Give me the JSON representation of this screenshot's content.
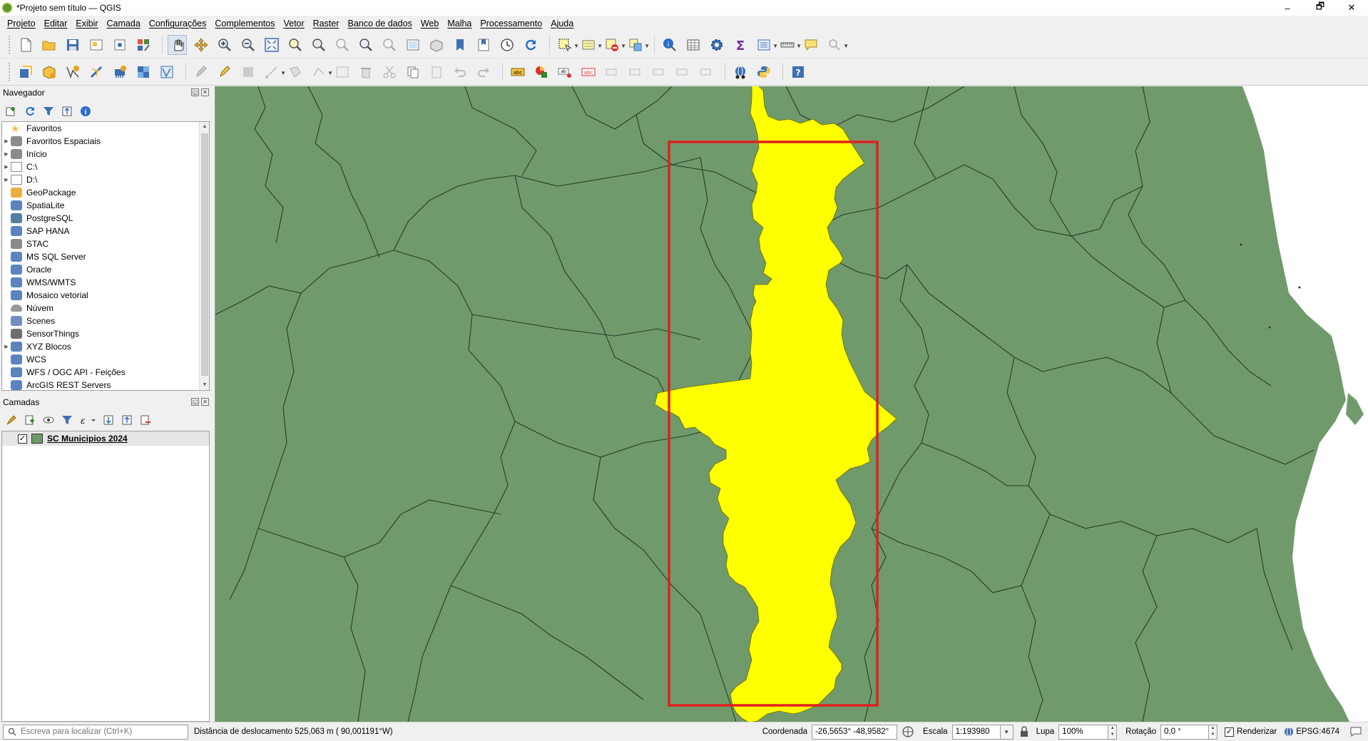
{
  "window": {
    "title": "*Projeto sem título — QGIS",
    "minimize": "–",
    "maximize": "🗗",
    "close": "✕"
  },
  "menu": [
    "Projeto",
    "Editar",
    "Exibir",
    "Camada",
    "Configurações",
    "Complementos",
    "Vetor",
    "Raster",
    "Banco de dados",
    "Web",
    "Malha",
    "Processamento",
    "Ajuda"
  ],
  "browser": {
    "title": "Navegador",
    "items": [
      {
        "label": "Favoritos",
        "icon": "star-icon",
        "expand": false
      },
      {
        "label": "Favoritos Espaciais",
        "icon": "spatial-bookmarks-icon",
        "expand": true
      },
      {
        "label": "Início",
        "icon": "home-folder-icon",
        "expand": true
      },
      {
        "label": "C:\\",
        "icon": "folder-icon",
        "expand": true
      },
      {
        "label": "D:\\",
        "icon": "folder-icon",
        "expand": true
      },
      {
        "label": "GeoPackage",
        "icon": "geopackage-icon",
        "expand": false
      },
      {
        "label": "SpatiaLite",
        "icon": "spatialite-icon",
        "expand": false
      },
      {
        "label": "PostgreSQL",
        "icon": "postgresql-icon",
        "expand": false
      },
      {
        "label": "SAP HANA",
        "icon": "sap-hana-icon",
        "expand": false
      },
      {
        "label": "STAC",
        "icon": "stac-icon",
        "expand": false
      },
      {
        "label": "MS SQL Server",
        "icon": "mssql-icon",
        "expand": false
      },
      {
        "label": "Oracle",
        "icon": "oracle-icon",
        "expand": false
      },
      {
        "label": "WMS/WMTS",
        "icon": "wms-icon",
        "expand": false
      },
      {
        "label": "Mosaico vetorial",
        "icon": "vector-tile-icon",
        "expand": false
      },
      {
        "label": "Núvem",
        "icon": "cloud-icon",
        "expand": false
      },
      {
        "label": "Scenes",
        "icon": "scenes-icon",
        "expand": false
      },
      {
        "label": "SensorThings",
        "icon": "sensorthings-icon",
        "expand": false
      },
      {
        "label": "XYZ Blocos",
        "icon": "xyz-tiles-icon",
        "expand": true
      },
      {
        "label": "WCS",
        "icon": "wcs-icon",
        "expand": false
      },
      {
        "label": "WFS / OGC API - Feições",
        "icon": "wfs-icon",
        "expand": false
      },
      {
        "label": "ArcGIS REST Servers",
        "icon": "arcgis-icon",
        "expand": false
      }
    ]
  },
  "layers": {
    "title": "Camadas",
    "items": [
      {
        "name": "SC Municipios 2024",
        "checked": true,
        "color": "#709a6c"
      }
    ]
  },
  "map": {
    "background": "#709a6c",
    "highlight": "#ffff00",
    "frame": "#e02020",
    "water": "#ffffff"
  },
  "status": {
    "search_placeholder": "Escreva para localizar (Ctrl+K)",
    "message": "Distância de deslocamento 525,063 m ( 90,001191°W)",
    "coord_label": "Coordenada",
    "coord_value": "-26,5653° -48,9582°",
    "scale_label": "Escala",
    "scale_value": "1:193980",
    "magnifier_label": "Lupa",
    "magnifier_value": "100%",
    "rotation_label": "Rotação",
    "rotation_value": "0,0 °",
    "render_label": "Renderizar",
    "crs": "EPSG:4674"
  }
}
